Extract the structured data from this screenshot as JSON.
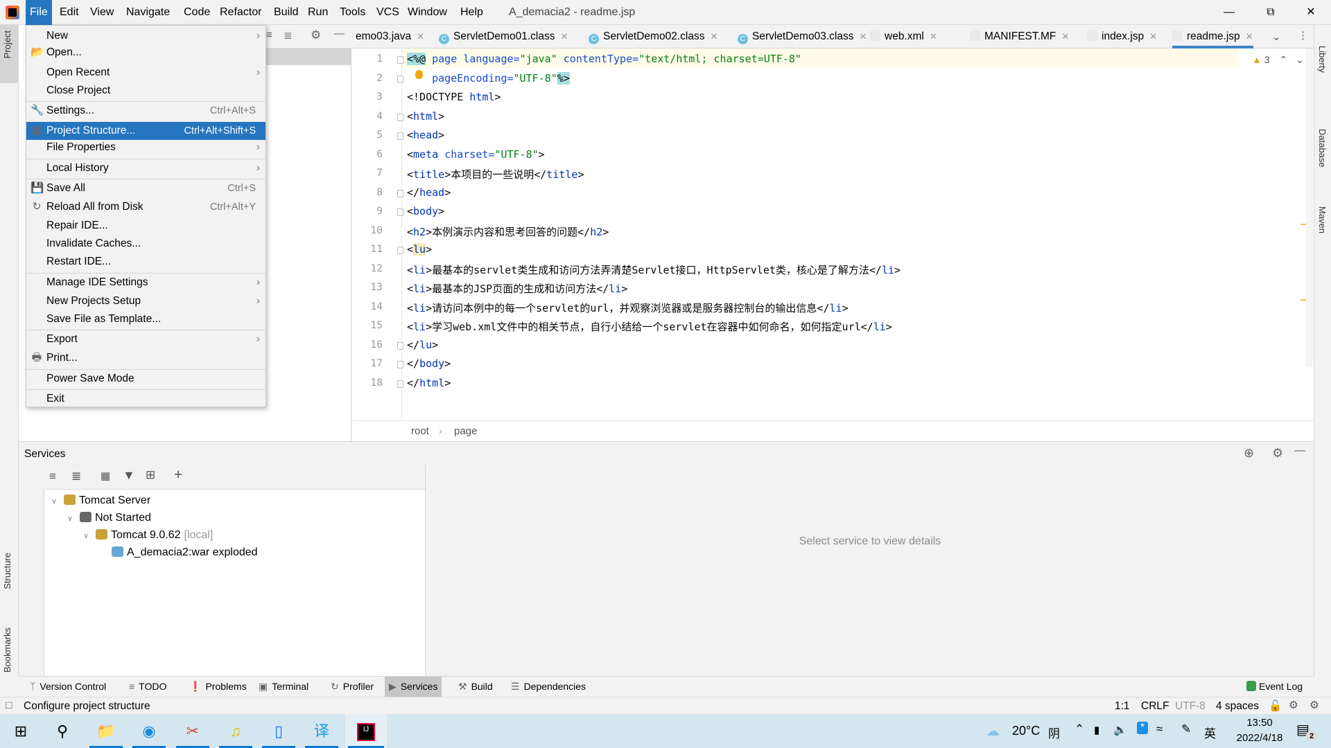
{
  "menubar": {
    "items": [
      "File",
      "Edit",
      "View",
      "Navigate",
      "Code",
      "Refactor",
      "Build",
      "Run",
      "Tools",
      "VCS",
      "Window",
      "Help"
    ],
    "active": "File",
    "window_title": "A_demacia2 - readme.jsp"
  },
  "file_menu": [
    {
      "label": "New",
      "submenu": true
    },
    {
      "label": "Open...",
      "icon": "folder-icon"
    },
    {
      "label": "Open Recent",
      "submenu": true
    },
    {
      "label": "Close Project"
    },
    {
      "label": "Settings...",
      "shortcut": "Ctrl+Alt+S",
      "icon": "wrench-icon"
    },
    {
      "label": "Project Structure...",
      "shortcut": "Ctrl+Alt+Shift+S",
      "icon": "project-structure-icon",
      "highlighted": true
    },
    {
      "label": "File Properties",
      "submenu": true
    },
    {
      "label": "Local History",
      "submenu": true
    },
    {
      "label": "Save All",
      "shortcut": "Ctrl+S",
      "icon": "save-icon"
    },
    {
      "label": "Reload All from Disk",
      "shortcut": "Ctrl+Alt+Y",
      "icon": "reload-icon"
    },
    {
      "label": "Repair IDE..."
    },
    {
      "label": "Invalidate Caches..."
    },
    {
      "label": "Restart IDE..."
    },
    {
      "label": "Manage IDE Settings",
      "submenu": true
    },
    {
      "label": "New Projects Setup",
      "submenu": true
    },
    {
      "label": "Save File as Template..."
    },
    {
      "label": "Export",
      "submenu": true
    },
    {
      "label": "Print...",
      "icon": "print-icon"
    },
    {
      "label": "Power Save Mode"
    },
    {
      "label": "Exit"
    }
  ],
  "side_stripes": {
    "left": [
      "Project",
      "Structure",
      "Bookmarks"
    ],
    "right": [
      "Liberty",
      "Database",
      "Maven"
    ]
  },
  "tabs": [
    {
      "label": "emo03.java",
      "icon": "java-icon"
    },
    {
      "label": "ServletDemo01.class",
      "icon": "class-icon"
    },
    {
      "label": "ServletDemo02.class",
      "icon": "class-icon"
    },
    {
      "label": "ServletDemo03.class",
      "icon": "class-icon"
    },
    {
      "label": "web.xml",
      "icon": "xml-icon"
    },
    {
      "label": "MANIFEST.MF",
      "icon": "manifest-icon"
    },
    {
      "label": "index.jsp",
      "icon": "jsp-icon"
    },
    {
      "label": "readme.jsp",
      "icon": "jsp-icon",
      "selected": true
    }
  ],
  "editor": {
    "warnings": "3",
    "lines": [
      [
        [
          "<%@",
          "dir"
        ],
        [
          " page ",
          "attr"
        ],
        [
          "language=",
          "attr"
        ],
        [
          "\"java\"",
          "val"
        ],
        [
          " contentType=",
          "attr"
        ],
        [
          "\"text/html; charset=UTF-8\"",
          "val"
        ]
      ],
      [
        [
          "    pageEncoding=",
          "attr"
        ],
        [
          "\"UTF-8\"",
          "val"
        ],
        [
          "%>",
          "dir"
        ]
      ],
      [
        [
          "<!DOCTYPE ",
          "br"
        ],
        [
          "html",
          "tag"
        ],
        [
          ">",
          "br"
        ]
      ],
      [
        [
          "<",
          "br"
        ],
        [
          "html",
          "tag"
        ],
        [
          ">",
          "br"
        ]
      ],
      [
        [
          "<",
          "br"
        ],
        [
          "head",
          "tag"
        ],
        [
          ">",
          "br"
        ]
      ],
      [
        [
          "<",
          "br"
        ],
        [
          "meta ",
          "tag"
        ],
        [
          "charset=",
          "attr"
        ],
        [
          "\"UTF-8\"",
          "val"
        ],
        [
          ">",
          "br"
        ]
      ],
      [
        [
          "<",
          "br"
        ],
        [
          "title",
          "tag"
        ],
        [
          ">本项目的一些说明</",
          "br"
        ],
        [
          "title",
          "tag"
        ],
        [
          ">",
          "br"
        ]
      ],
      [
        [
          "</",
          "br"
        ],
        [
          "head",
          "tag"
        ],
        [
          ">",
          "br"
        ]
      ],
      [
        [
          "<",
          "br"
        ],
        [
          "body",
          "tag"
        ],
        [
          ">",
          "br"
        ]
      ],
      [
        [
          "<",
          "br"
        ],
        [
          "h2",
          "tag"
        ],
        [
          ">本例演示内容和思考回答的问题</",
          "br"
        ],
        [
          "h2",
          "tag"
        ],
        [
          ">",
          "br"
        ]
      ],
      [
        [
          "<",
          "br"
        ],
        [
          "lu",
          "hl"
        ],
        [
          ">",
          "br"
        ]
      ],
      [
        [
          "<",
          "br"
        ],
        [
          "li",
          "tag"
        ],
        [
          ">最基本的servlet类生成和访问方法弄清楚Servlet接口，HttpServlet类，核心是了解方法</",
          "br"
        ],
        [
          "li",
          "tag"
        ],
        [
          ">",
          "br"
        ]
      ],
      [
        [
          "<",
          "br"
        ],
        [
          "li",
          "tag"
        ],
        [
          ">最基本的JSP页面的生成和访问方法</",
          "br"
        ],
        [
          "li",
          "tag"
        ],
        [
          ">",
          "br"
        ]
      ],
      [
        [
          "<",
          "br"
        ],
        [
          "li",
          "tag"
        ],
        [
          ">请访问本例中的每一个servlet的url，并观察浏览器或是服务器控制台的输出信息</",
          "br"
        ],
        [
          "li",
          "tag"
        ],
        [
          ">",
          "br"
        ]
      ],
      [
        [
          "<",
          "br"
        ],
        [
          "li",
          "tag"
        ],
        [
          ">学习web.xml文件中的相关节点，自行小结给一个servlet在容器中如何命名，如何指定url</",
          "br"
        ],
        [
          "li",
          "tag"
        ],
        [
          ">",
          "br"
        ]
      ],
      [
        [
          "</",
          "br"
        ],
        [
          "lu",
          "tag"
        ],
        [
          ">",
          "br"
        ]
      ],
      [
        [
          "</",
          "br"
        ],
        [
          "body",
          "tag"
        ],
        [
          ">",
          "br"
        ]
      ],
      [
        [
          "</",
          "br"
        ],
        [
          "html",
          "tag"
        ],
        [
          ">",
          "br"
        ]
      ]
    ],
    "breadcrumb": [
      "root",
      "page"
    ]
  },
  "services": {
    "title": "Services",
    "empty_text": "Select service to view details",
    "tree": [
      {
        "label": "Tomcat Server",
        "icon": "tomcat-icon",
        "level": 0,
        "expanded": true
      },
      {
        "label": "Not Started",
        "icon": "wrench-icon",
        "level": 1,
        "expanded": true
      },
      {
        "label": "Tomcat 9.0.62",
        "suffix": "[local]",
        "icon": "tomcat-icon",
        "level": 2,
        "expanded": true
      },
      {
        "label": "A_demacia2:war exploded",
        "icon": "artifact-icon",
        "level": 3
      }
    ]
  },
  "tool_windows": [
    {
      "label": "Version Control"
    },
    {
      "label": "TODO"
    },
    {
      "label": "Problems"
    },
    {
      "label": "Terminal"
    },
    {
      "label": "Profiler"
    },
    {
      "label": "Services",
      "selected": true
    },
    {
      "label": "Build"
    },
    {
      "label": "Dependencies"
    }
  ],
  "event_log": "Event Log",
  "status": {
    "message": "Configure project structure",
    "position": "1:1",
    "line_sep": "CRLF",
    "encoding": "UTF-8",
    "indent": "4 spaces"
  },
  "taskbar": {
    "weather": "20°C",
    "condition": "阴",
    "ime": "英",
    "time": "13:50",
    "date": "2022/4/18",
    "notifications": "2"
  },
  "colors": {
    "accent": "#2675bf",
    "tab_underline": "#4083c9"
  }
}
